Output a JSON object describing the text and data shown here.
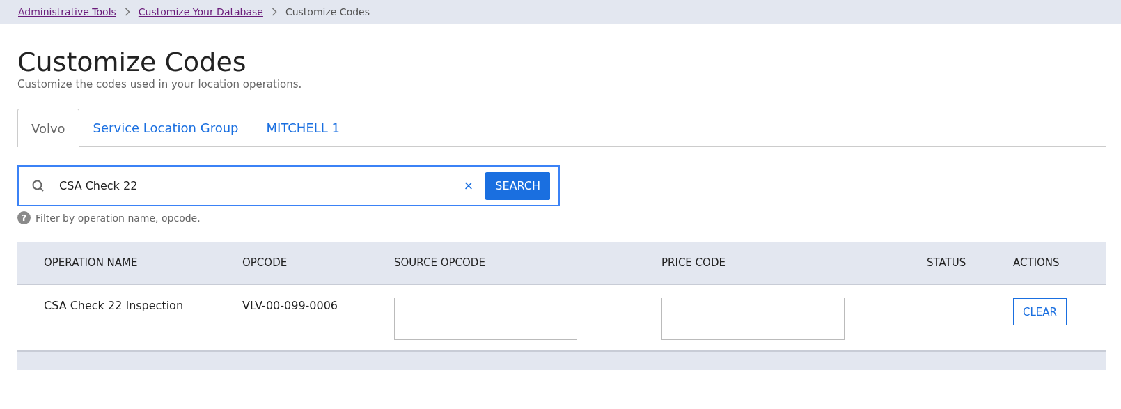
{
  "breadcrumbs": [
    {
      "label": "Administrative Tools",
      "kind": "link"
    },
    {
      "label": "Customize Your Database",
      "kind": "link"
    },
    {
      "label": "Customize Codes",
      "kind": "current"
    }
  ],
  "page": {
    "title": "Customize Codes",
    "subtitle": "Customize the codes used in your location operations."
  },
  "tabs": [
    {
      "label": "Volvo",
      "selected": true
    },
    {
      "label": "Service Location Group",
      "selected": false
    },
    {
      "label": "MITCHELL 1",
      "selected": false
    }
  ],
  "search": {
    "value": "CSA Check 22",
    "clear_label": "×",
    "button": "SEARCH",
    "hint_icon": "?",
    "hint": "Filter by operation name, opcode."
  },
  "table": {
    "columns": [
      "OPERATION NAME",
      "OPCODE",
      "SOURCE OPCODE",
      "PRICE CODE",
      "STATUS",
      "ACTIONS"
    ],
    "rows": [
      {
        "operation_name": "CSA Check 22 Inspection",
        "opcode": "VLV-00-099-0006",
        "action": "CLEAR"
      }
    ]
  }
}
